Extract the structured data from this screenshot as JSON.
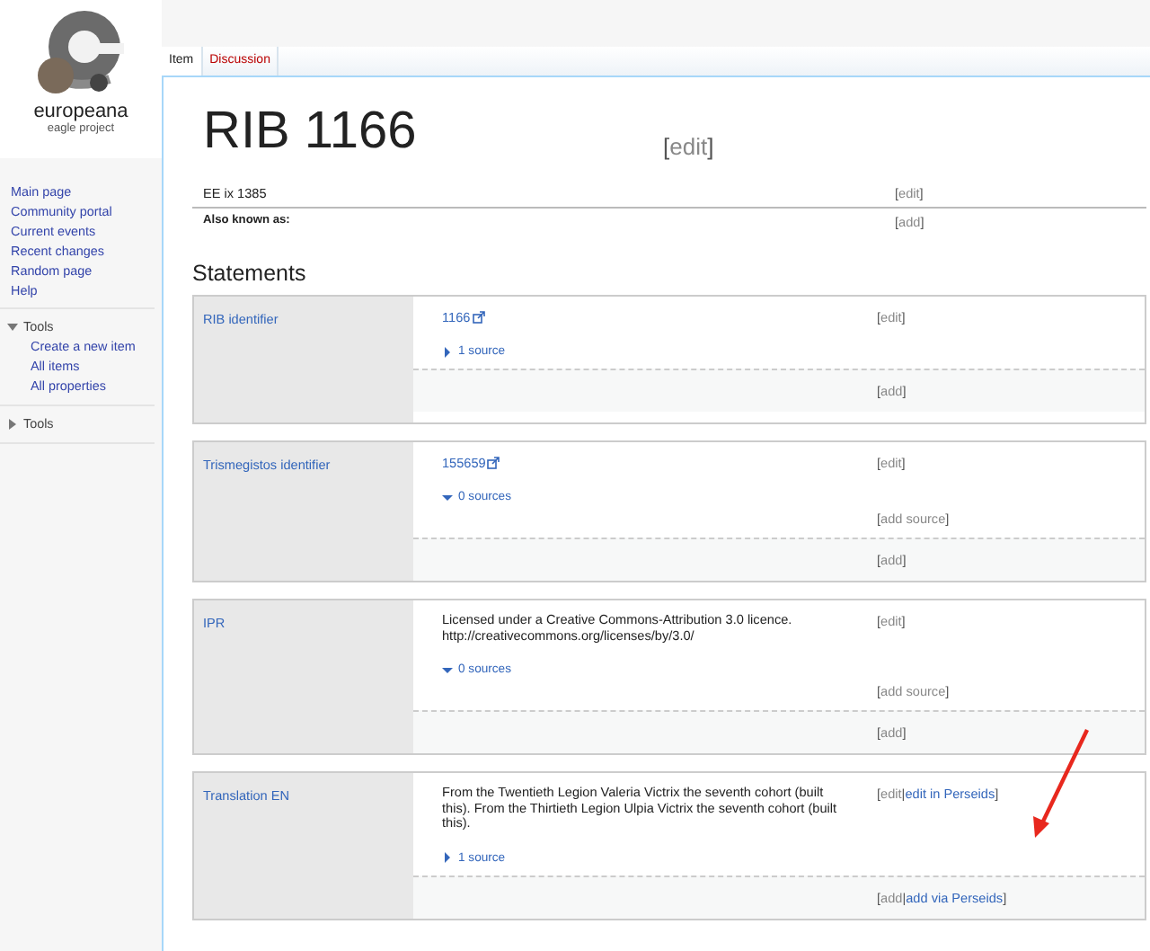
{
  "logo": {
    "name": "europeana",
    "subtitle": "eagle project"
  },
  "nav": {
    "links": [
      "Main page",
      "Community portal",
      "Current events",
      "Recent changes",
      "Random page",
      "Help"
    ],
    "sections": [
      {
        "title": "Tools",
        "expanded": true,
        "items": [
          "Create a new item",
          "All items",
          "All properties"
        ]
      },
      {
        "title": "Tools",
        "expanded": false
      }
    ]
  },
  "tabs": [
    {
      "label": "Item",
      "selected": true
    },
    {
      "label": "Discussion",
      "selected": false
    }
  ],
  "title": "RIB 1166",
  "title_actions": [
    {
      "text": "[",
      "kind": "punct"
    },
    {
      "text": "edit",
      "kind": "plain"
    },
    {
      "text": "]",
      "kind": "punct"
    }
  ],
  "description": {
    "text": "EE ix 1385",
    "actions": [
      {
        "text": "[",
        "kind": "punct"
      },
      {
        "text": "edit",
        "kind": "plain"
      },
      {
        "text": "]",
        "kind": "punct"
      }
    ]
  },
  "aliases": {
    "label": "Also known as:",
    "actions": [
      {
        "text": "[",
        "kind": "punct"
      },
      {
        "text": "add",
        "kind": "plain"
      },
      {
        "text": "]",
        "kind": "punct"
      }
    ]
  },
  "statements_heading": "Statements",
  "statements": [
    {
      "property": "RIB identifier",
      "kind": "link",
      "value": "1166",
      "actions": [
        {
          "text": "[",
          "kind": "punct"
        },
        {
          "text": "edit",
          "kind": "plain"
        },
        {
          "text": "]",
          "kind": "punct"
        }
      ],
      "sources": {
        "label": "1 source",
        "expanded": false
      },
      "add_actions": [
        {
          "text": "[",
          "kind": "punct"
        },
        {
          "text": "add",
          "kind": "plain"
        },
        {
          "text": "]",
          "kind": "punct"
        }
      ]
    },
    {
      "property": "Trismegistos identifier",
      "kind": "link",
      "value": "155659",
      "actions": [
        {
          "text": "[",
          "kind": "punct"
        },
        {
          "text": "edit",
          "kind": "plain"
        },
        {
          "text": "]",
          "kind": "punct"
        }
      ],
      "sources": {
        "label": "0 sources",
        "expanded": true
      },
      "source_actions": [
        {
          "text": "[",
          "kind": "punct"
        },
        {
          "text": "add source",
          "kind": "plain"
        },
        {
          "text": "]",
          "kind": "punct"
        }
      ],
      "add_actions": [
        {
          "text": "[",
          "kind": "punct"
        },
        {
          "text": "add",
          "kind": "plain"
        },
        {
          "text": "]",
          "kind": "punct"
        }
      ]
    },
    {
      "property": "IPR",
      "kind": "text",
      "value": "Licensed under a Creative Commons-Attribution 3.0 licence. http://creativecommons.org/licenses/by/3.0/",
      "actions": [
        {
          "text": "[",
          "kind": "punct"
        },
        {
          "text": "edit",
          "kind": "plain"
        },
        {
          "text": "]",
          "kind": "punct"
        }
      ],
      "sources": {
        "label": "0 sources",
        "expanded": true
      },
      "source_actions": [
        {
          "text": "[",
          "kind": "punct"
        },
        {
          "text": "add source",
          "kind": "plain"
        },
        {
          "text": "]",
          "kind": "punct"
        }
      ],
      "add_actions": [
        {
          "text": "[",
          "kind": "punct"
        },
        {
          "text": "add",
          "kind": "plain"
        },
        {
          "text": "]",
          "kind": "punct"
        }
      ]
    },
    {
      "property": "Translation EN",
      "kind": "text",
      "value": "From the Twentieth Legion Valeria Victrix the seventh cohort (built this). From the Thirtieth Legion Ulpia Victrix the seventh cohort (built this).",
      "actions": [
        {
          "text": "[",
          "kind": "punct"
        },
        {
          "text": "edit",
          "kind": "plain"
        },
        {
          "text": "|",
          "kind": "punct"
        },
        {
          "text": "edit in Perseids",
          "kind": "link"
        },
        {
          "text": "]",
          "kind": "punct"
        }
      ],
      "sources": {
        "label": "1 source",
        "expanded": false
      },
      "add_actions": [
        {
          "text": "[",
          "kind": "punct"
        },
        {
          "text": "add",
          "kind": "plain"
        },
        {
          "text": "|",
          "kind": "punct"
        },
        {
          "text": "add via Perseids",
          "kind": "link"
        },
        {
          "text": "]",
          "kind": "punct"
        }
      ]
    }
  ]
}
